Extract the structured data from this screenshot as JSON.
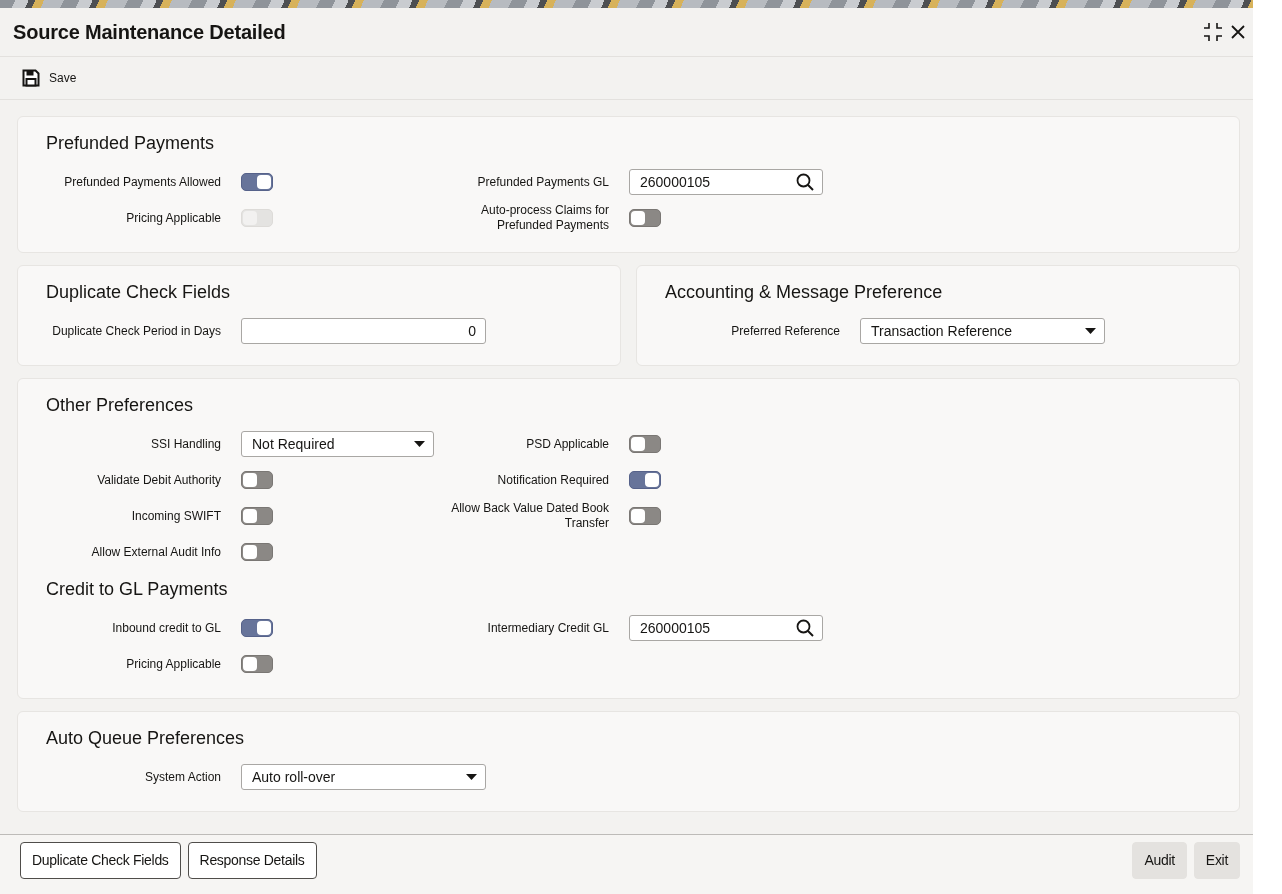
{
  "window": {
    "title": "Source Maintenance Detailed"
  },
  "toolbar": {
    "save_label": "Save"
  },
  "panel_rows": [
    {
      "panels": [
        {
          "sections": [
            {
              "title": "Prefunded Payments",
              "left": [
                {
                  "kind": "toggle",
                  "label": "Prefunded Payments Allowed",
                  "on": true,
                  "disabled": false
                },
                {
                  "kind": "toggle",
                  "label": "Pricing Applicable",
                  "on": false,
                  "disabled": true
                }
              ],
              "right": [
                {
                  "kind": "lookup",
                  "label": "Prefunded Payments GL",
                  "value": "260000105"
                },
                {
                  "kind": "toggle",
                  "label": "Auto-process Claims for Prefunded Payments",
                  "on": false,
                  "disabled": false
                }
              ]
            }
          ]
        }
      ]
    },
    {
      "panels": [
        {
          "sections": [
            {
              "title": "Duplicate Check Fields",
              "left": [
                {
                  "kind": "number",
                  "label": "Duplicate Check Period in Days",
                  "value": "0"
                }
              ]
            }
          ]
        },
        {
          "sections": [
            {
              "title": "Accounting & Message Preference",
              "left": [
                {
                  "kind": "select",
                  "label": "Preferred Reference",
                  "value": "Transaction Reference"
                }
              ]
            }
          ]
        }
      ]
    },
    {
      "panels": [
        {
          "sections": [
            {
              "title": "Other Preferences",
              "left": [
                {
                  "kind": "select",
                  "label": "SSI Handling",
                  "value": "Not Required"
                },
                {
                  "kind": "toggle",
                  "label": "Validate Debit Authority",
                  "on": false,
                  "disabled": false
                },
                {
                  "kind": "toggle",
                  "label": "Incoming SWIFT",
                  "on": false,
                  "disabled": false
                },
                {
                  "kind": "toggle",
                  "label": "Allow External Audit Info",
                  "on": false,
                  "disabled": false
                }
              ],
              "right": [
                {
                  "kind": "toggle",
                  "label": "PSD Applicable",
                  "on": false,
                  "disabled": false
                },
                {
                  "kind": "toggle",
                  "label": "Notification Required",
                  "on": true,
                  "disabled": false
                },
                {
                  "kind": "toggle",
                  "label": "Allow Back Value Dated Book Transfer",
                  "on": false,
                  "disabled": false
                }
              ]
            },
            {
              "title": "Credit to GL Payments",
              "left": [
                {
                  "kind": "toggle",
                  "label": "Inbound credit to GL",
                  "on": true,
                  "disabled": false
                },
                {
                  "kind": "toggle",
                  "label": "Pricing Applicable",
                  "on": false,
                  "disabled": false
                }
              ],
              "right": [
                {
                  "kind": "lookup",
                  "label": "Intermediary Credit GL",
                  "value": "260000105"
                }
              ]
            }
          ]
        }
      ]
    },
    {
      "panels": [
        {
          "sections": [
            {
              "title": "Auto Queue Preferences",
              "left": [
                {
                  "kind": "select",
                  "label": "System Action",
                  "value": "Auto roll-over"
                }
              ]
            }
          ]
        }
      ]
    }
  ],
  "footer": {
    "left_buttons": [
      "Duplicate Check Fields",
      "Response Details"
    ],
    "right_buttons": [
      "Audit",
      "Exit"
    ]
  }
}
